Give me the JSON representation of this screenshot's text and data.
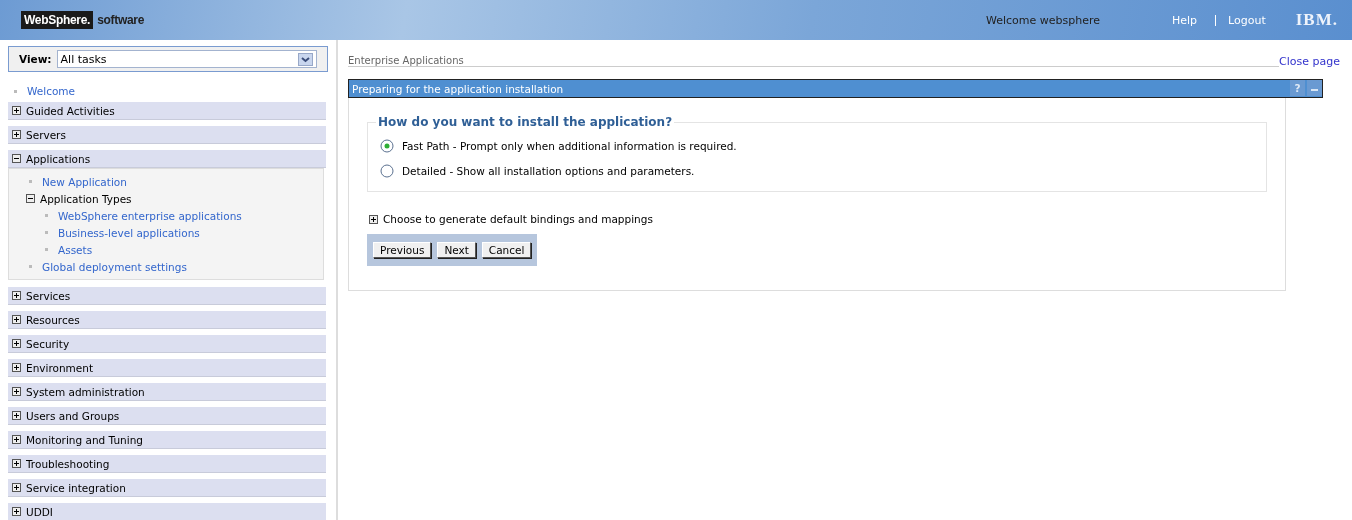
{
  "header": {
    "brand": "WebSphere.",
    "brand_suffix": "software",
    "welcome": "Welcome websphere",
    "links": [
      "Help",
      "Logout"
    ],
    "logo": "IBM."
  },
  "sidebar": {
    "view_label": "View:",
    "view_value": "All tasks",
    "welcome_link": "Welcome",
    "sections": [
      {
        "label": "Guided Activities",
        "expanded": false
      },
      {
        "label": "Servers",
        "expanded": false
      },
      {
        "label": "Applications",
        "expanded": true,
        "children": [
          {
            "kind": "link",
            "label": "New Application"
          },
          {
            "kind": "group",
            "label": "Application Types",
            "expanded": true,
            "children": [
              {
                "label": "WebSphere enterprise applications"
              },
              {
                "label": "Business-level applications"
              },
              {
                "label": "Assets"
              }
            ]
          },
          {
            "kind": "link",
            "label": "Global deployment settings"
          }
        ]
      },
      {
        "label": "Services",
        "expanded": false
      },
      {
        "label": "Resources",
        "expanded": false
      },
      {
        "label": "Security",
        "expanded": false
      },
      {
        "label": "Environment",
        "expanded": false
      },
      {
        "label": "System administration",
        "expanded": false
      },
      {
        "label": "Users and Groups",
        "expanded": false
      },
      {
        "label": "Monitoring and Tuning",
        "expanded": false
      },
      {
        "label": "Troubleshooting",
        "expanded": false
      },
      {
        "label": "Service integration",
        "expanded": false
      },
      {
        "label": "UDDI",
        "expanded": false
      }
    ]
  },
  "main": {
    "breadcrumb": "Enterprise Applications",
    "close_link": "Close page",
    "panel": {
      "title": "Preparing for the application installation",
      "help": "?",
      "question": "How do you want to install the application?",
      "options": [
        {
          "label": "Fast Path - Prompt only when additional information is required.",
          "selected": true
        },
        {
          "label": "Detailed - Show all installation options and parameters.",
          "selected": false
        }
      ],
      "expander": {
        "label": "Choose to generate default bindings and mappings",
        "expanded": false
      },
      "buttons": [
        "Previous",
        "Next",
        "Cancel"
      ]
    }
  }
}
